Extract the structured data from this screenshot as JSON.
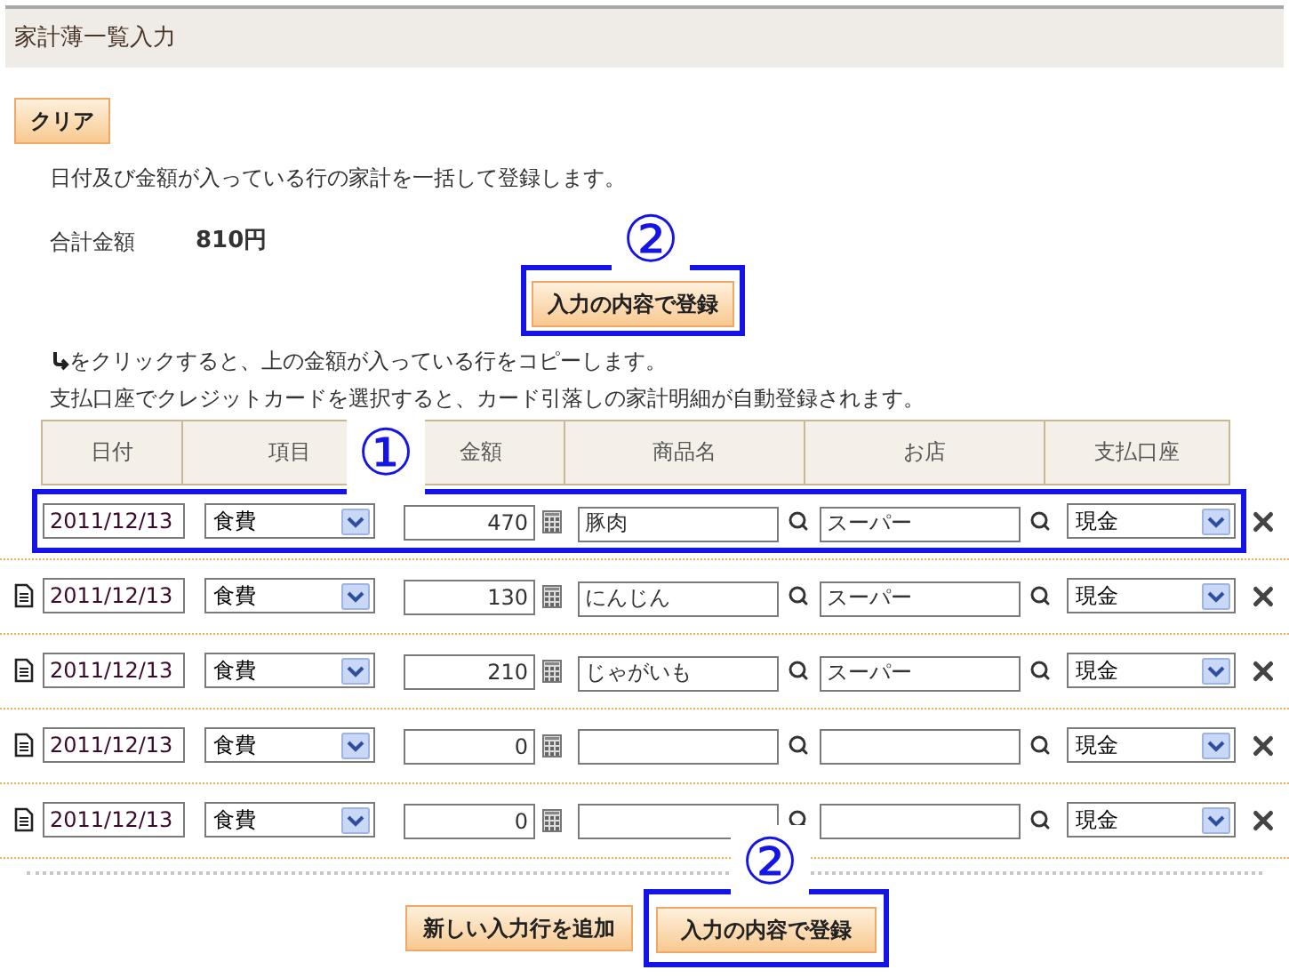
{
  "title": "家計薄一覧入力",
  "clear_button": "クリア",
  "description": "日付及び金額が入っている行の家計を一括して登録します。",
  "total": {
    "label": "合計金額",
    "value": "810円"
  },
  "submit_top": {
    "label": "入力の内容で登録",
    "highlighted": true
  },
  "hints": [
    "をクリックすると、上の金額が入っている行をコピーします。",
    "支払口座でクレジットカードを選択すると、カード引落しの家計明細が自動登録されます。"
  ],
  "table": {
    "columns": [
      "日付",
      "項目",
      "金額",
      "商品名",
      "お店",
      "支払口座"
    ],
    "rows": [
      {
        "copy_button": false,
        "highlighted": true,
        "date": "2011/12/13",
        "category": "食費",
        "amount": "470",
        "product": "豚肉",
        "shop": "スーパー",
        "account": "現金"
      },
      {
        "copy_button": true,
        "highlighted": false,
        "date": "2011/12/13",
        "category": "食費",
        "amount": "130",
        "product": "にんじん",
        "shop": "スーパー",
        "account": "現金"
      },
      {
        "copy_button": true,
        "highlighted": false,
        "date": "2011/12/13",
        "category": "食費",
        "amount": "210",
        "product": "じゃがいも",
        "shop": "スーパー",
        "account": "現金"
      },
      {
        "copy_button": true,
        "highlighted": false,
        "date": "2011/12/13",
        "category": "食費",
        "amount": "0",
        "account": "現金"
      },
      {
        "copy_button": true,
        "highlighted": false,
        "date": "2011/12/13",
        "category": "食費",
        "amount": "0",
        "account": "現金"
      }
    ]
  },
  "add_row_button": "新しい入力行を追加",
  "submit_bottom": {
    "label": "入力の内容で登録",
    "highlighted": true
  },
  "annotations": [
    {
      "label": "②"
    },
    {
      "label": "①"
    },
    {
      "label": "②"
    }
  ]
}
